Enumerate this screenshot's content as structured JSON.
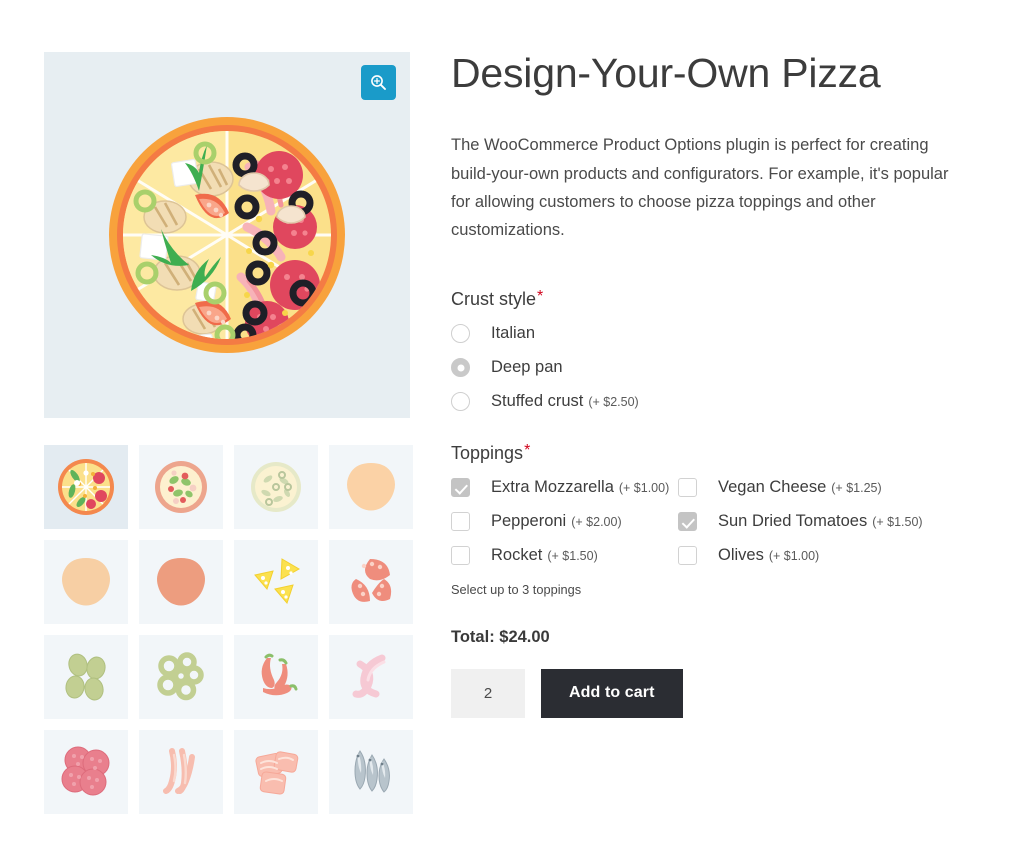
{
  "colors": {
    "accent_zoom": "#1a9bc9",
    "required_asterisk": "#d0021b",
    "cart_button_bg": "#2b2d33",
    "gallery_bg": "#e7eef2",
    "thumb_bg": "#f2f6f9",
    "thumb_selected_bg": "#e3ebf1"
  },
  "gallery": {
    "zoom_button": {
      "icon": "magnifier-plus-icon",
      "label": "Zoom"
    },
    "main_image": {
      "alt": "Design-Your-Own Pizza",
      "icon": "pizza-whole-icon"
    },
    "thumbnails": [
      {
        "icon": "pizza-supreme-icon",
        "selected": true
      },
      {
        "icon": "pizza-veggie-icon",
        "selected": false
      },
      {
        "icon": "pizza-white-icon",
        "selected": false
      },
      {
        "icon": "dough-plain-icon",
        "selected": false
      },
      {
        "icon": "dough-base-icon",
        "selected": false
      },
      {
        "icon": "tomato-sauce-base-icon",
        "selected": false
      },
      {
        "icon": "cheese-wedges-icon",
        "selected": false
      },
      {
        "icon": "tomato-slices-icon",
        "selected": false
      },
      {
        "icon": "green-olives-icon",
        "selected": false
      },
      {
        "icon": "olive-rings-icon",
        "selected": false
      },
      {
        "icon": "chili-peppers-icon",
        "selected": false
      },
      {
        "icon": "prawns-icon",
        "selected": false
      },
      {
        "icon": "salami-slices-icon",
        "selected": false
      },
      {
        "icon": "bacon-strips-icon",
        "selected": false
      },
      {
        "icon": "ham-slices-icon",
        "selected": false
      },
      {
        "icon": "anchovies-icon",
        "selected": false
      }
    ]
  },
  "product": {
    "title": "Design-Your-Own Pizza",
    "description": "The WooCommerce Product Options plugin is perfect for creating build-your-own products and configurators. For example, it's popular for allowing customers to choose pizza toppings and other customizations."
  },
  "crust": {
    "label": "Crust style",
    "required_mark": "*",
    "options": [
      {
        "label": "Italian",
        "price": "",
        "checked": false
      },
      {
        "label": "Deep pan",
        "price": "",
        "checked": true
      },
      {
        "label": "Stuffed crust",
        "price": "(+ $2.50)",
        "checked": false
      }
    ]
  },
  "toppings": {
    "label": "Toppings",
    "required_mark": "*",
    "help_text": "Select up to 3 toppings",
    "left_column": [
      {
        "label": "Extra Mozzarella",
        "price": "(+ $1.00)",
        "checked": true
      },
      {
        "label": "Pepperoni",
        "price": "(+ $2.00)",
        "checked": false
      },
      {
        "label": "Rocket",
        "price": "(+ $1.50)",
        "checked": false
      }
    ],
    "right_column": [
      {
        "label": "Vegan Cheese",
        "price": "(+ $1.25)",
        "checked": false
      },
      {
        "label": "Sun Dried Tomatoes",
        "price": "(+ $1.50)",
        "checked": true
      },
      {
        "label": "Olives",
        "price": "(+ $1.00)",
        "checked": false
      }
    ]
  },
  "purchase": {
    "total_label": "Total: $24.00",
    "quantity_value": "2",
    "quantity_placeholder": "1",
    "add_to_cart_label": "Add to cart"
  }
}
